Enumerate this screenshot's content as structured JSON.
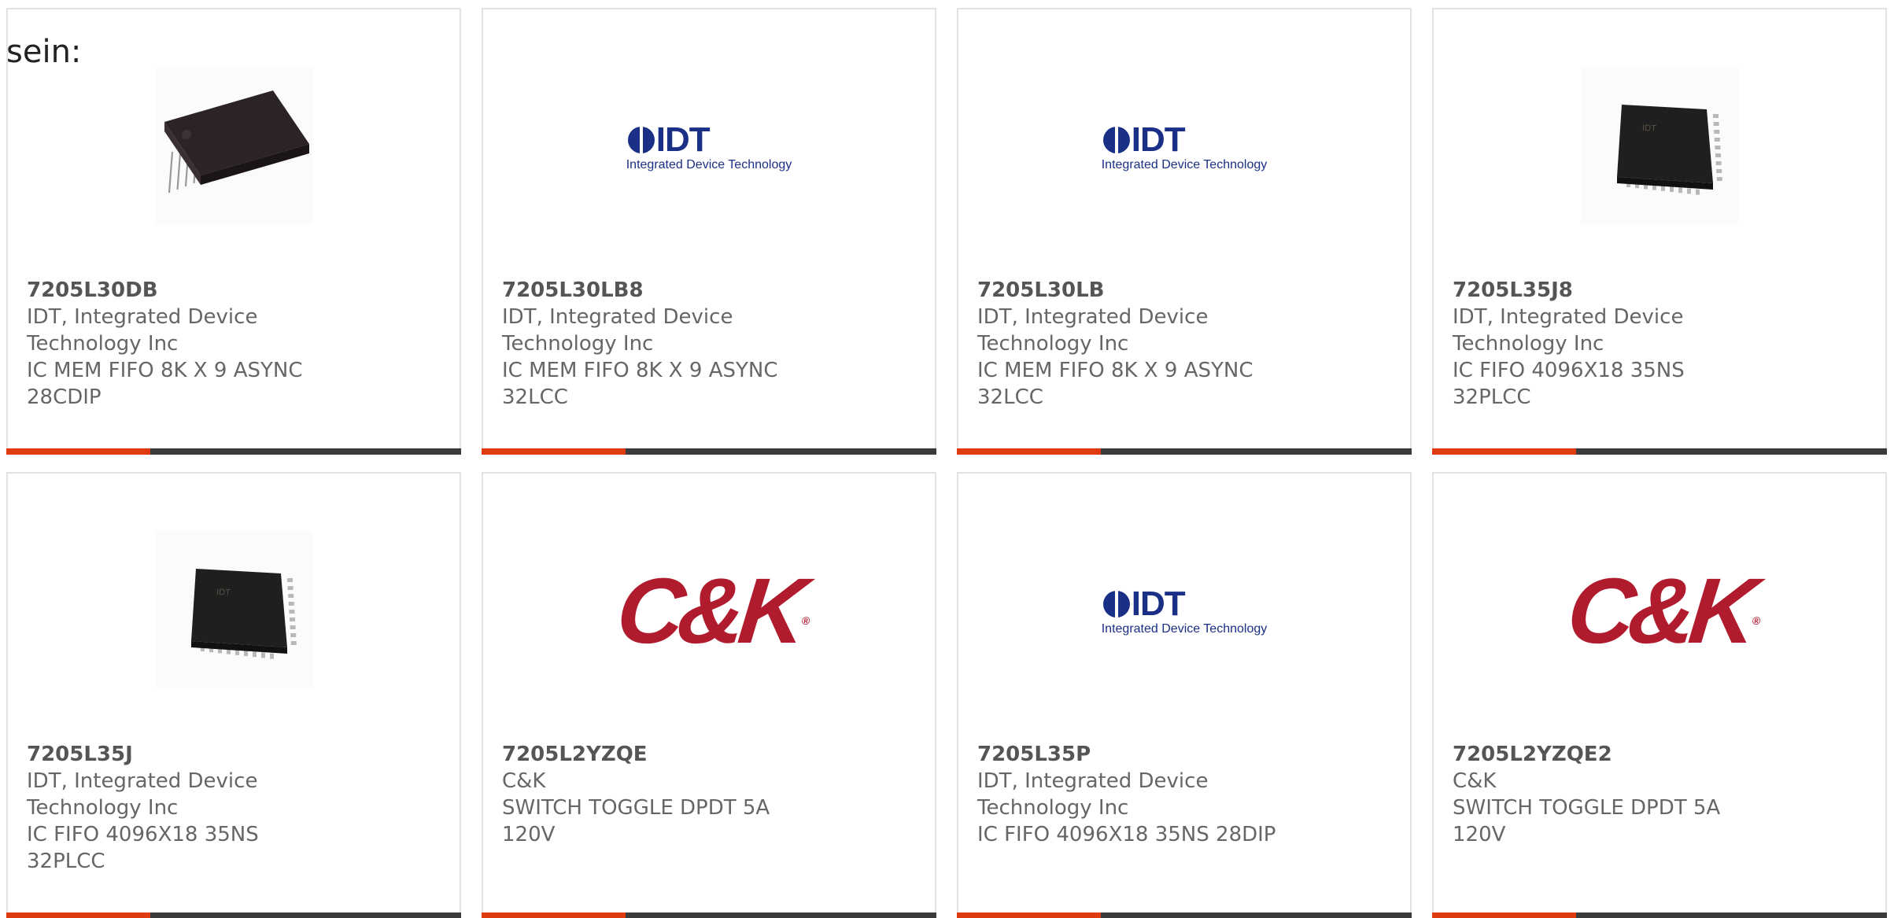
{
  "intro_text": "sein:",
  "colors": {
    "accent": "#e03a10",
    "bar": "#3b3b3b",
    "idt_blue": "#1a2f86",
    "ck_red": "#b01c2e"
  },
  "logos": {
    "idt": {
      "word": "IDT",
      "tagline": "Integrated Device Technology"
    },
    "ck": {
      "word": "C&K",
      "mark": "®"
    }
  },
  "products": [
    {
      "part": "7205L30DB",
      "maker_line1": "IDT, Integrated Device",
      "maker_line2": "Technology Inc",
      "description": "IC MEM FIFO 8K X 9 ASYNC 28CDIP",
      "image": "dip-chip-image"
    },
    {
      "part": "7205L30LB8",
      "maker_line1": "IDT, Integrated Device",
      "maker_line2": "Technology Inc",
      "description": "IC MEM FIFO 8K X 9 ASYNC 32LCC",
      "image": "idt-logo"
    },
    {
      "part": "7205L30LB",
      "maker_line1": "IDT, Integrated Device",
      "maker_line2": "Technology Inc",
      "description": "IC MEM FIFO 8K X 9 ASYNC 32LCC",
      "image": "idt-logo"
    },
    {
      "part": "7205L35J8",
      "maker_line1": "IDT, Integrated Device",
      "maker_line2": "Technology Inc",
      "description": "IC FIFO 4096X18 35NS 32PLCC",
      "image": "plcc-chip-image"
    },
    {
      "part": "7205L35J",
      "maker_line1": "IDT, Integrated Device",
      "maker_line2": "Technology Inc",
      "description": "IC FIFO 4096X18 35NS 32PLCC",
      "image": "plcc-chip-image"
    },
    {
      "part": "7205L2YZQE",
      "maker_line1": "C&K",
      "maker_line2": "",
      "description": "SWITCH TOGGLE DPDT 5A 120V",
      "image": "ck-logo"
    },
    {
      "part": "7205L35P",
      "maker_line1": "IDT, Integrated Device",
      "maker_line2": "Technology Inc",
      "description": "IC FIFO 4096X18 35NS 28DIP",
      "image": "idt-logo"
    },
    {
      "part": "7205L2YZQE2",
      "maker_line1": "C&K",
      "maker_line2": "",
      "description": "SWITCH TOGGLE DPDT 5A 120V",
      "image": "ck-logo"
    }
  ]
}
